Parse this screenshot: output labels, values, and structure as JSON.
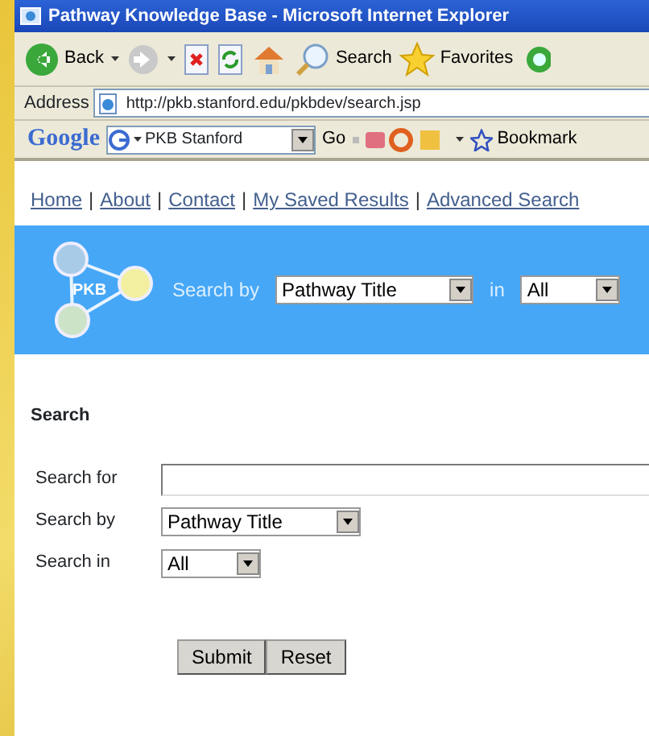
{
  "window": {
    "title": "Pathway Knowledge Base - Microsoft Internet Explorer"
  },
  "toolbar": {
    "buttons": [
      {
        "kind": "back",
        "label": "Back",
        "menu": true
      },
      {
        "kind": "forward",
        "menu": true
      },
      {
        "kind": "stop"
      },
      {
        "kind": "refresh"
      },
      {
        "kind": "home"
      },
      {
        "kind": "search",
        "label": "Search"
      },
      {
        "kind": "favorites",
        "label": "Favorites"
      },
      {
        "kind": "media"
      }
    ]
  },
  "address_bar": {
    "label": "Address",
    "url": "http://pkb.stanford.edu/pkbdev/search.jsp"
  },
  "google_bar": {
    "logo": "Google",
    "search_value": "PKB Stanford",
    "go": "Go",
    "bookmarks": "Bookmark"
  },
  "nav_links": [
    {
      "label": "Home"
    },
    {
      "label": "About",
      "separator": "|"
    },
    {
      "label": "Contact",
      "separator": "|"
    },
    {
      "label": "My Saved Results",
      "separator": "|"
    },
    {
      "label": "Advanced Search",
      "separator": "|"
    }
  ],
  "banner": {
    "logo": "PKB",
    "search_by_label": "Search by",
    "search_by_value": "Pathway Title",
    "in_label": "in",
    "in_value": "All"
  },
  "form": {
    "title": "Search",
    "rows": [
      {
        "label": "Search for",
        "kind": "text"
      },
      {
        "label": "Search by",
        "kind": "select",
        "value": "Pathway Title"
      },
      {
        "label": "Search in",
        "kind": "select",
        "value": "All"
      }
    ],
    "buttons": [
      "Submit",
      "Reset"
    ]
  }
}
